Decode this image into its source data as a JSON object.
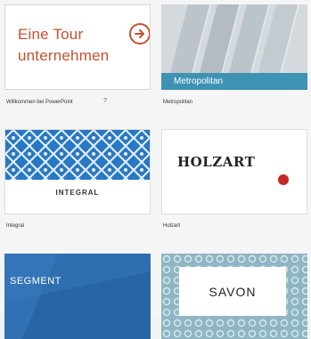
{
  "templates": [
    {
      "id": "tour",
      "thumb_lines": [
        "Eine Tour",
        "unternehmen"
      ],
      "caption": "Willkommen bei PowerPoint",
      "pin": "?",
      "accent": "#c5512f"
    },
    {
      "id": "metropolitan",
      "thumb_label": "Metropolitan",
      "caption": "Metropolitan",
      "accent": "#3e92b4"
    },
    {
      "id": "integral",
      "thumb_label": "INTEGRAL",
      "caption": "Integral",
      "accent": "#2a78c2"
    },
    {
      "id": "holzart",
      "thumb_label": "HOLZART",
      "caption": "Holzart",
      "accent": "#c62828"
    },
    {
      "id": "segment",
      "thumb_label": "SEGMENT",
      "accent": "#2f6fb0"
    },
    {
      "id": "savon",
      "thumb_label": "SAVON",
      "accent": "#8fb6c4"
    }
  ]
}
